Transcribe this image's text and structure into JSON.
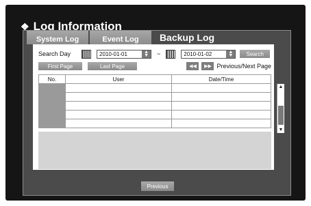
{
  "window": {
    "title": "Log Information"
  },
  "tabs": [
    {
      "label": "System Log",
      "active": false
    },
    {
      "label": "Event Log",
      "active": false
    },
    {
      "label": "Backup Log",
      "active": true
    }
  ],
  "search": {
    "label": "Search Day",
    "start_date": "2010-01-01",
    "separator": "~",
    "end_date": "2010-01-02",
    "button": "Search"
  },
  "paging": {
    "first_page": "First Page",
    "last_page": "Last Page",
    "prev_arrow": "◀◀",
    "next_arrow": "▶▶",
    "prev_next_label": "Previous/Next Page"
  },
  "table": {
    "columns": [
      "No.",
      "User",
      "Date/Time"
    ],
    "rows": [
      [
        "",
        "",
        ""
      ],
      [
        "",
        "",
        ""
      ],
      [
        "",
        "",
        ""
      ],
      [
        "",
        "",
        ""
      ],
      [
        "",
        "",
        ""
      ]
    ]
  },
  "footer": {
    "previous": "Previous"
  },
  "colors": {
    "background": "#151515",
    "dialog": "#4b4b4b",
    "tab": "#9c9c9c",
    "button": "#8f8f8f"
  }
}
